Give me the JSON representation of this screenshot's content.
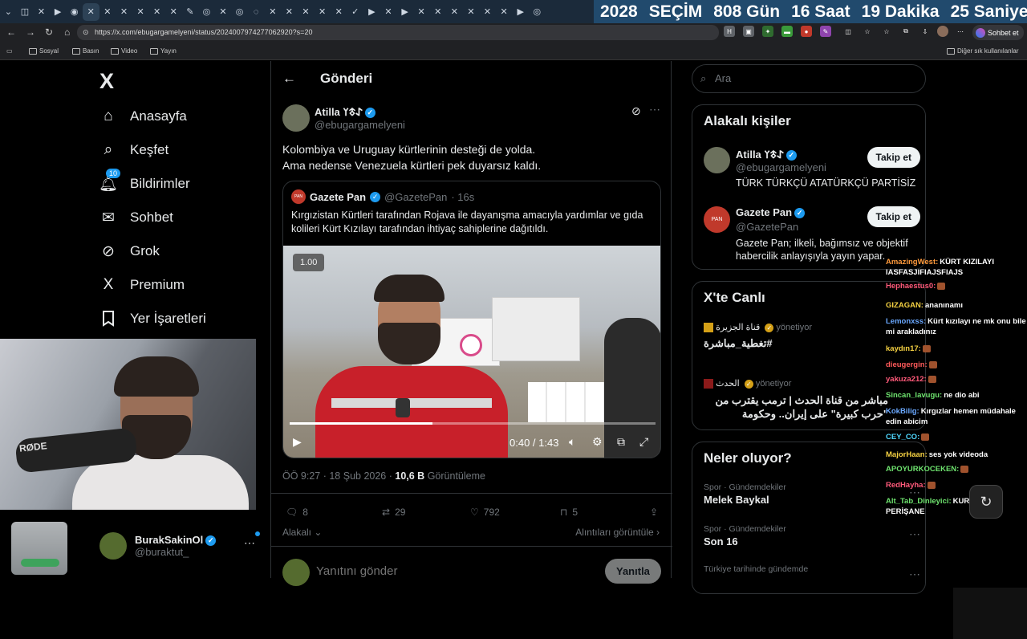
{
  "browser": {
    "tabs": [
      "⌄",
      "◫",
      "✕",
      "▶",
      "◉",
      "✕",
      "✕",
      "✕",
      "✕",
      "✕",
      "✕",
      "✎",
      "◎",
      "✕",
      "◎",
      "◌",
      "✕",
      "✕",
      "✕",
      "✕",
      "✕",
      "✓",
      "▶",
      "✕",
      "▶",
      "✕",
      "✕",
      "✕",
      "✕",
      "✕",
      "✕",
      "▶",
      "◎"
    ],
    "countdown": [
      "2028",
      "SEÇİM",
      "808 Gün",
      "16 Saat",
      "19 Dakika",
      "25 Saniye"
    ],
    "url": "https://x.com/ebugargamelyeni/status/2024007974277062920?s=20",
    "copilot_label": "Sohbet et",
    "bookmarks": [
      "Sosyal",
      "Basın",
      "Video",
      "Yayın"
    ],
    "other_bookmarks": "Diğer sık kullanılanlar"
  },
  "nav": {
    "logo": "X",
    "items": [
      {
        "label": "Anasayfa",
        "icon": "⌂"
      },
      {
        "label": "Keşfet",
        "icon": "⌕"
      },
      {
        "label": "Bildirimler",
        "icon": "♫",
        "badge": "10"
      },
      {
        "label": "Sohbet",
        "icon": "✉"
      },
      {
        "label": "Grok",
        "icon": "⊘"
      },
      {
        "label": "Premium",
        "icon": "X"
      },
      {
        "label": "Yer İşaretleri",
        "icon": "⊓"
      }
    ],
    "account": {
      "name": "BurakSakinOl",
      "handle": "@buraktut_"
    }
  },
  "post": {
    "header": "Gönderi",
    "author": "Atilla 𐰀𐱃𐰠",
    "handle": "@ebugargamelyeni",
    "text_line1": "Kolombiya ve Uruguay kürtlerinin desteği de yolda.",
    "text_line2": "Ama nedense Venezuela kürtleri pek duyarsız kaldı.",
    "quote": {
      "author": "Gazete Pan",
      "handle": "@GazetePan",
      "time": "· 16s",
      "text": "Kırgızistan Kürtleri tarafından Rojava ile dayanışma amacıyla yardımlar ve gıda kolileri Kürt Kızılayı tarafından ihtiyaç sahiplerine dağıtıldı.",
      "video": {
        "speed": "1.00",
        "current": "0:40",
        "total": "1:43",
        "progress": 0.39
      }
    },
    "time": "ÖÖ 9:27 · 18 Şub 2026 ·",
    "views": "10,6 B",
    "views_label": "Görüntüleme",
    "stats": {
      "replies": "8",
      "reposts": "29",
      "likes": "792",
      "bookmarks": "5"
    },
    "relevant": "Alakalı",
    "view_quotes": "Alıntıları görüntüle",
    "reply_placeholder": "Yanıtını gönder",
    "reply_button": "Yanıtla"
  },
  "sidebar": {
    "search_placeholder": "Ara",
    "related_title": "Alakalı kişiler",
    "people": [
      {
        "name": "Atilla 𐰀𐱃𐰠",
        "handle": "@ebugargamelyeni",
        "bio": "TÜRK TÜRKÇÜ ATATÜRKÇÜ PARTİSİZ",
        "follow": "Takip et"
      },
      {
        "name": "Gazete Pan",
        "handle": "@GazetePan",
        "bio": "Gazete Pan; ilkeli, bağımsız ve objektif habercilik anlayışıyla yayın yapar.",
        "follow": "Takip et"
      }
    ],
    "live_title": "X'te Canlı",
    "live": [
      {
        "host": "قناة الجزيرة",
        "role": "yönetiyor",
        "title": "تغطية_مباشرة#"
      },
      {
        "host": "الحدث",
        "role": "yönetiyor",
        "title": "مباشر من قناة الحدث | ترمب يقترب من \"حرب كبيرة\" على إيران.. وحكومة"
      }
    ],
    "trends_title": "Neler oluyor?",
    "trends": [
      {
        "category": "Spor · Gündemdekiler",
        "name": "Melek Baykal"
      },
      {
        "category": "Spor · Gündemdekiler",
        "name": "Son 16"
      },
      {
        "category": "Türkiye tarihinde gündemde",
        "name": ""
      }
    ]
  },
  "chat": [
    {
      "user": "AmazingWest:",
      "msg": "KÜRT KIZILAYI IASFASJIFIAJSFIAJS",
      "color": "#ff9a3c"
    },
    {
      "user": "Hephaestus0:",
      "msg": "",
      "color": "#ff5a7a"
    },
    {
      "user": "GIZAGAN:",
      "msg": "ananınamı",
      "color": "#f5d142"
    },
    {
      "user": "Lemonxss:",
      "msg": "Kürt kızılayı ne mk onu bile mi arakladınız",
      "color": "#6aa8ff"
    },
    {
      "user": "kaydın17:",
      "msg": "",
      "color": "#f5d142"
    },
    {
      "user": "dieugergin:",
      "msg": "",
      "color": "#ff5a5a"
    },
    {
      "user": "yakuza212:",
      "msg": "",
      "color": "#ff5a7a"
    },
    {
      "user": "Sincan_lavugu:",
      "msg": "ne dio abi",
      "color": "#6ee36e"
    },
    {
      "user": "KokBilig:",
      "msg": "Kırgızlar hemen müdahale edin abicim",
      "color": "#6aa8ff"
    },
    {
      "user": "CEY_CO:",
      "msg": "",
      "color": "#4fd8ff"
    },
    {
      "user": "MajorHaan:",
      "msg": "ses yok videoda",
      "color": "#f5d142"
    },
    {
      "user": "APOYURKOCEKEN:",
      "msg": "",
      "color": "#6ee36e"
    },
    {
      "user": "RedHayha:",
      "msg": "",
      "color": "#ff5a7a"
    },
    {
      "user": "Alt_Tab_Dinleyici:",
      "msg": "KURDİSTANE PERİŞANE",
      "color": "#6ee36e"
    }
  ],
  "colors": {
    "accent": "#1d9bf0",
    "background": "#000000",
    "border": "#2f3336"
  }
}
